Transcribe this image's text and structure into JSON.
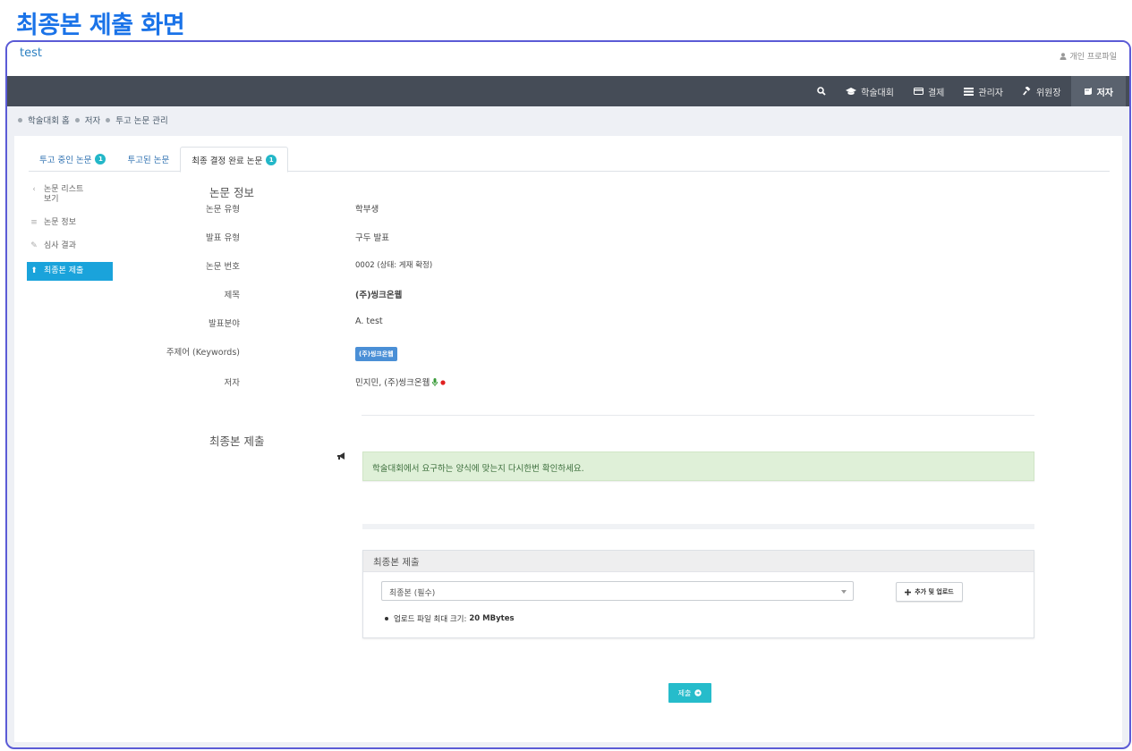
{
  "page_heading": "최종본 제출 화면",
  "app": {
    "brand": "test",
    "profile_link": "개인 프로파일"
  },
  "navbar": {
    "items": [
      {
        "label": "",
        "icon": "search-icon"
      },
      {
        "label": "학술대회",
        "icon": "graduation-cap-icon"
      },
      {
        "label": "결제",
        "icon": "credit-card-icon"
      },
      {
        "label": "관리자",
        "icon": "admin-icon"
      },
      {
        "label": "위원장",
        "icon": "gavel-icon"
      },
      {
        "label": "저자",
        "icon": "book-icon",
        "active": true
      }
    ]
  },
  "breadcrumb": [
    "학술대회 홈",
    "저자",
    "투고 논문 관리"
  ],
  "tabs": [
    {
      "label": "투고 중인 논문",
      "badge": "1"
    },
    {
      "label": "투고된 논문",
      "badge": ""
    },
    {
      "label": "최종 결정 완료 논문",
      "badge": "1",
      "active": true
    }
  ],
  "sidebar": {
    "items": [
      {
        "label": "논문 리스트 보기",
        "icon": "chevron-left-icon"
      },
      {
        "label": "논문 정보",
        "icon": "list-icon"
      },
      {
        "label": "심사 결과",
        "icon": "edit-icon"
      },
      {
        "label": "최종본 제출",
        "icon": "upload-icon",
        "active": true
      }
    ]
  },
  "paper_info": {
    "title": "논문 정보",
    "fields": [
      {
        "label": "논문 유형",
        "value": "학부생"
      },
      {
        "label": "발표 유형",
        "value": "구두 발표"
      },
      {
        "label": "논문 번호",
        "value": "0002 (상태: 게재 확정)"
      },
      {
        "label": "제목",
        "value": "(주)씽크온웹"
      },
      {
        "label": "발표분야",
        "value": "A. test"
      },
      {
        "label": "주제어 (Keywords)",
        "value": "(주)씽크온웹"
      },
      {
        "label": "저자",
        "value": "민지민, (주)씽크온웹"
      }
    ]
  },
  "final_submission": {
    "title": "최종본 제출",
    "notice": "학술대회에서 요구하는 양식에 맞는지 다시한번 확인하세요.",
    "box_title": "최종본 제출",
    "select_value": "최종본 (필수)",
    "add_button": "추가 및 업로드",
    "limit_label": "업로드 파일 최대 크기:",
    "limit_value": "20 MBytes",
    "submit_button": "제출"
  },
  "colors": {
    "heading_blue": "#1a73e8",
    "navbar_bg": "#454c57",
    "active_side": "#1aa3db",
    "badge": "#23b7c8",
    "alert_bg": "#dff0d8",
    "submit": "#26bccb"
  }
}
